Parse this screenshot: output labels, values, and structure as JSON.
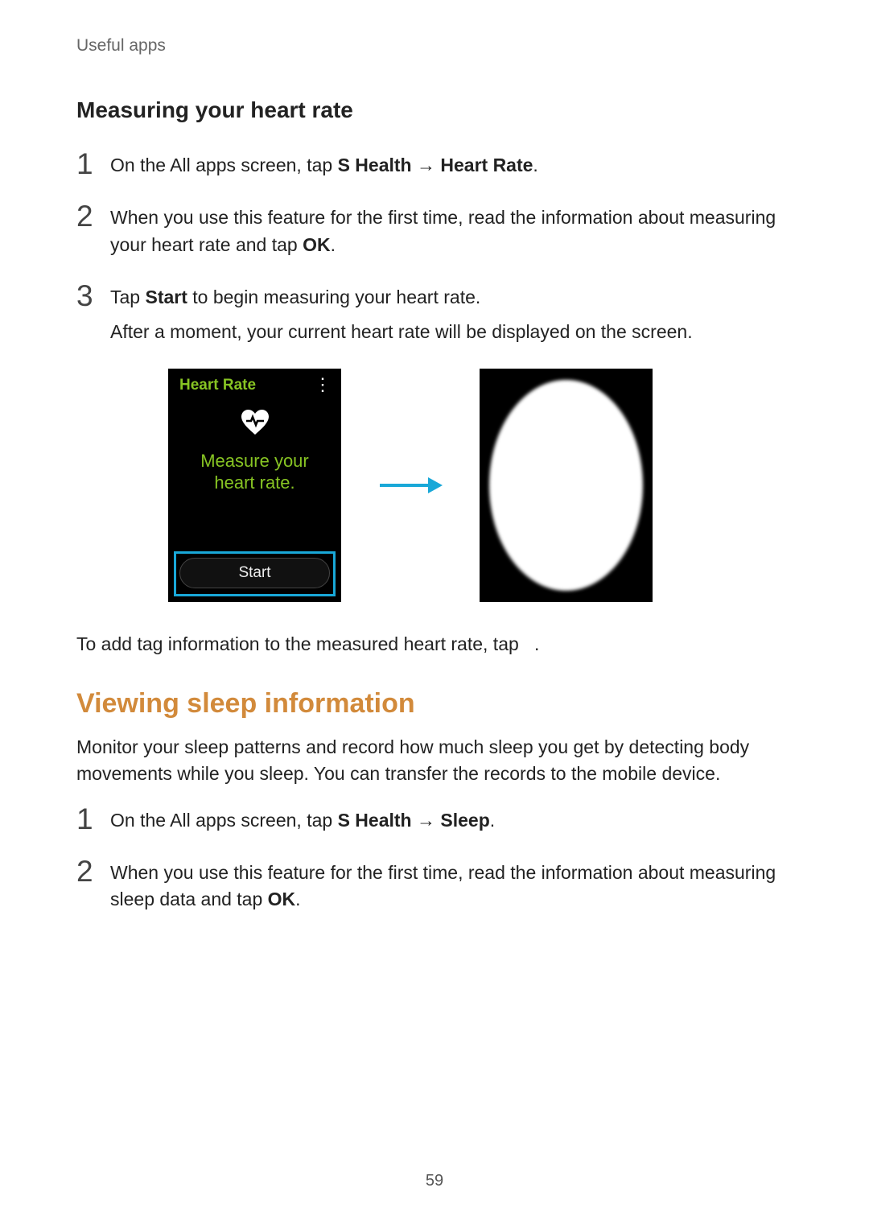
{
  "runningHead": "Useful apps",
  "pageNumber": "59",
  "sectionA": {
    "heading": "Measuring your heart rate",
    "steps": [
      {
        "num": "1",
        "pre": "On the All apps screen, tap ",
        "b1": "S Health",
        "arrow": " → ",
        "b2": "Heart Rate",
        "post": "."
      },
      {
        "num": "2",
        "pre": "When you use this feature for the first time, read the information about measuring your heart rate and tap ",
        "b1": "OK",
        "post": "."
      },
      {
        "num": "3",
        "pre": "Tap ",
        "b1": "Start",
        "post": " to begin measuring your heart rate.",
        "sub": "After a moment, your current heart rate will be displayed on the screen."
      }
    ],
    "tagNote": "To add tag information to the measured heart rate, tap ",
    "tagNotePost": "."
  },
  "figure": {
    "title": "Heart Rate",
    "promptLine1": "Measure your",
    "promptLine2": "heart rate.",
    "startLabel": "Start"
  },
  "sectionB": {
    "heading": "Viewing sleep information",
    "intro": "Monitor your sleep patterns and record how much sleep you get by detecting body movements while you sleep. You can transfer the records to the mobile device.",
    "steps": [
      {
        "num": "1",
        "pre": "On the All apps screen, tap ",
        "b1": "S Health",
        "arrow": " → ",
        "b2": "Sleep",
        "post": "."
      },
      {
        "num": "2",
        "pre": "When you use this feature for the first time, read the information about measuring sleep data and tap ",
        "b1": "OK",
        "post": "."
      }
    ]
  }
}
